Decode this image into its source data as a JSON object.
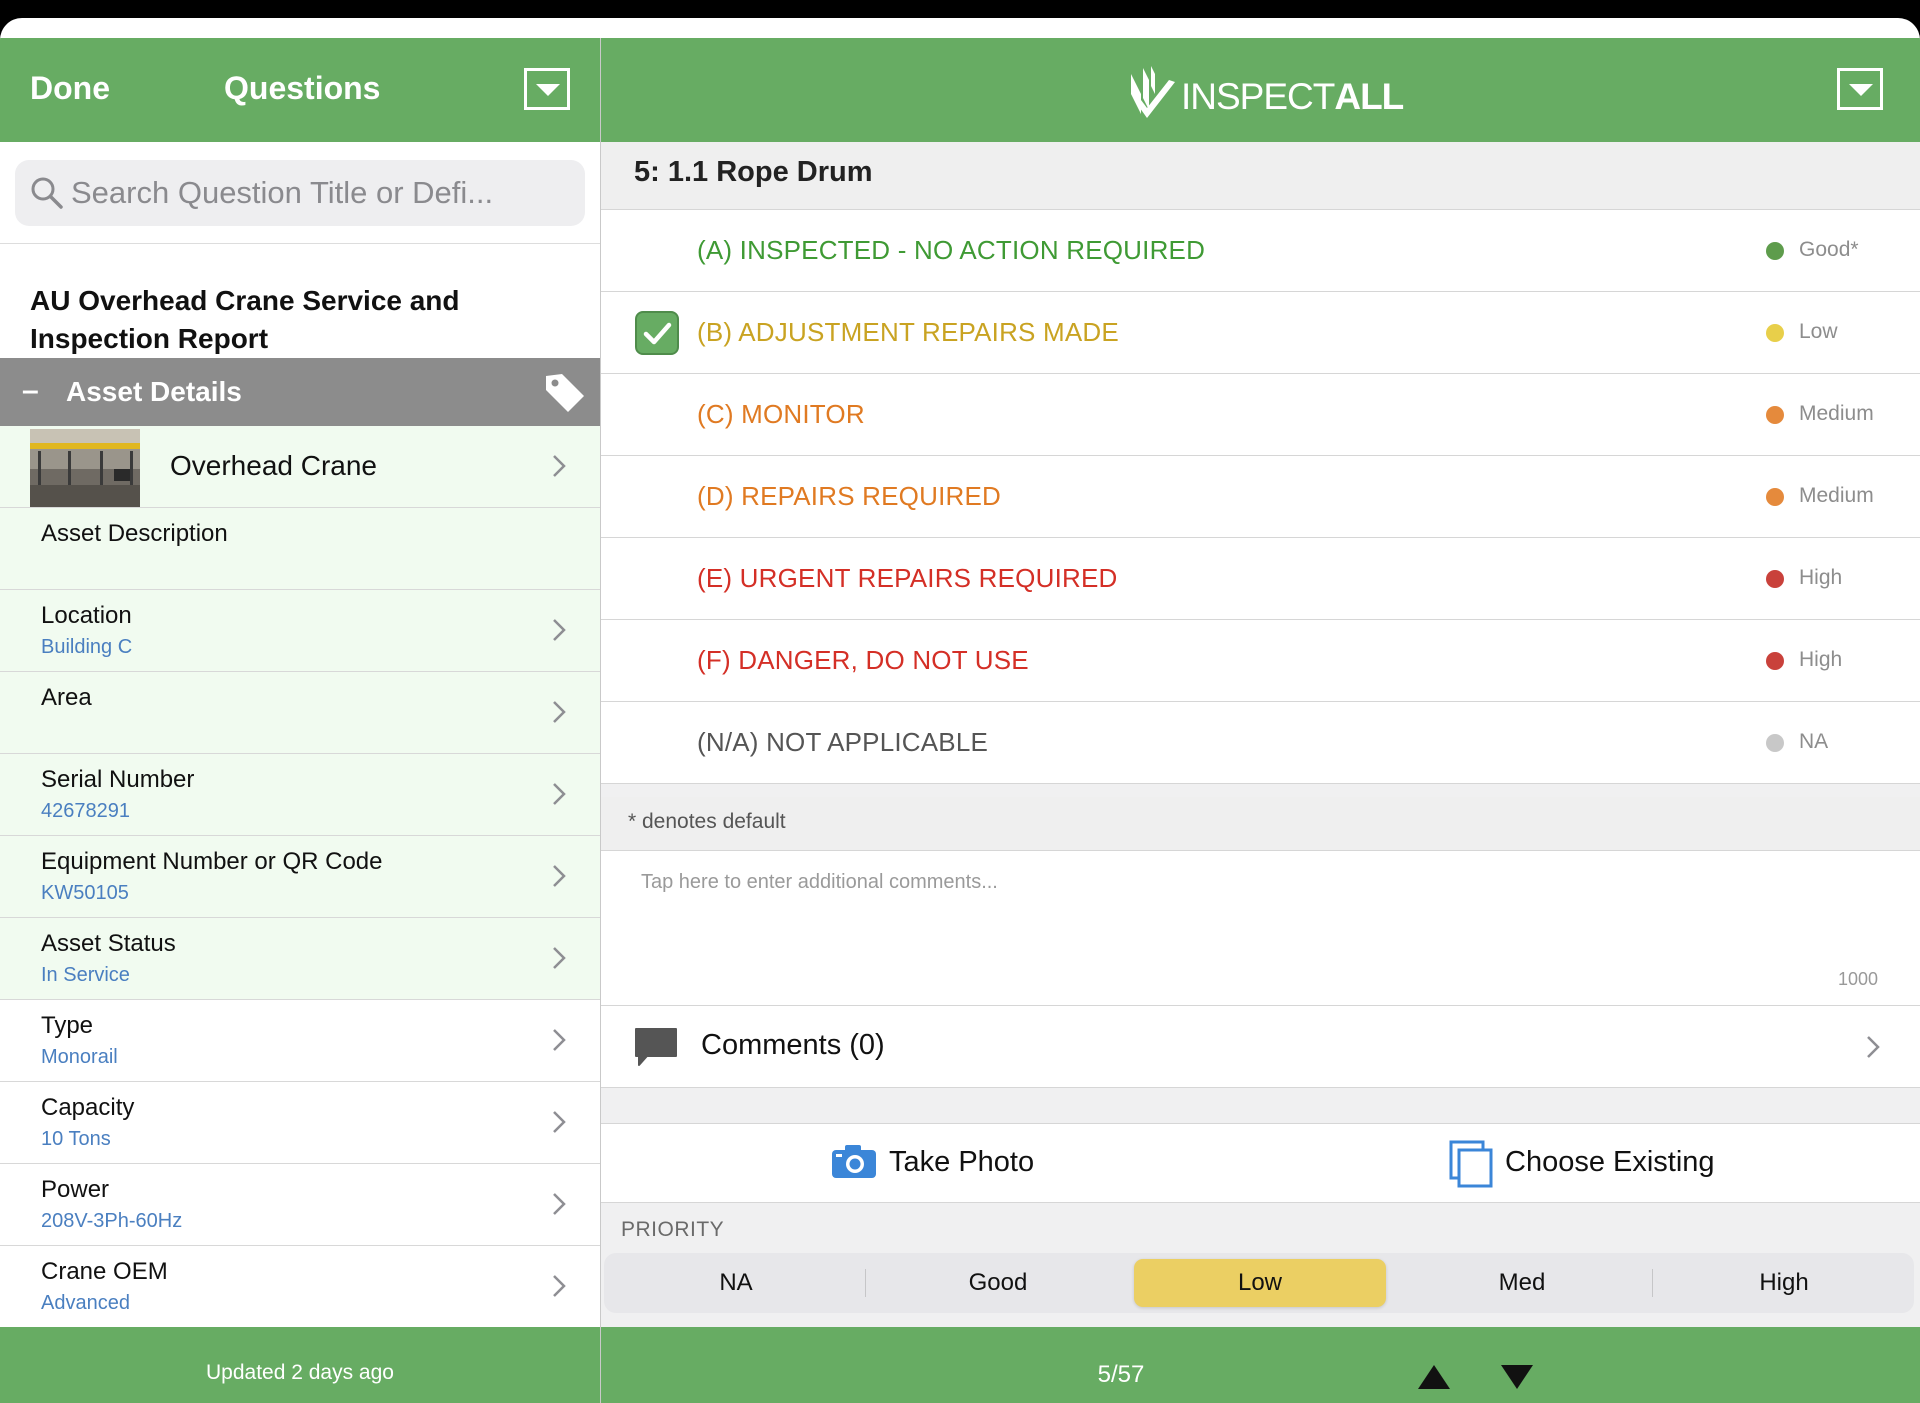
{
  "left": {
    "done_label": "Done",
    "title": "Questions",
    "search_placeholder": "Search Question Title or Defi...",
    "report_title": "AU Overhead Crane Service and Inspection Report",
    "section": {
      "toggle": "–",
      "title": "Asset Details"
    },
    "asset_name": "Overhead Crane",
    "fields": [
      {
        "label": "Asset Description",
        "value": ""
      },
      {
        "label": "Location",
        "value": "Building C"
      },
      {
        "label": "Area",
        "value": ""
      },
      {
        "label": "Serial Number",
        "value": "42678291"
      },
      {
        "label": "Equipment Number or QR Code",
        "value": "KW50105"
      },
      {
        "label": "Asset Status",
        "value": "In Service"
      },
      {
        "label": "Type",
        "value": "Monorail"
      },
      {
        "label": "Capacity",
        "value": "10 Tons"
      },
      {
        "label": "Power",
        "value": "208V-3Ph-60Hz"
      },
      {
        "label": "Crane OEM",
        "value": "Advanced"
      }
    ],
    "footer": "Updated 2 days ago"
  },
  "right": {
    "logo_text_light": "INSPECT",
    "logo_text_bold": "ALL",
    "question_title": "5: 1.1 Rope Drum",
    "options": [
      {
        "text": "(A) INSPECTED - NO ACTION REQUIRED",
        "priority": "Good*",
        "text_color": "#3f9a34",
        "dot_color": "#5e9c4c",
        "selected": false
      },
      {
        "text": "(B) ADJUSTMENT REPAIRS MADE",
        "priority": "Low",
        "text_color": "#c9a322",
        "dot_color": "#e8cf4a",
        "selected": true
      },
      {
        "text": "(C) MONITOR",
        "priority": "Medium",
        "text_color": "#e07a22",
        "dot_color": "#e58a3c",
        "selected": false
      },
      {
        "text": "(D) REPAIRS REQUIRED",
        "priority": "Medium",
        "text_color": "#e07a22",
        "dot_color": "#e58a3c",
        "selected": false
      },
      {
        "text": "(E) URGENT REPAIRS REQUIRED",
        "priority": "High",
        "text_color": "#d42f26",
        "dot_color": "#c9413b",
        "selected": false
      },
      {
        "text": "(F) DANGER, DO NOT USE",
        "priority": "High",
        "text_color": "#d42f26",
        "dot_color": "#c9413b",
        "selected": false
      },
      {
        "text": "(N/A) NOT APPLICABLE",
        "priority": "NA",
        "text_color": "#555555",
        "dot_color": "#c8c8c8",
        "selected": false
      }
    ],
    "default_note": "* denotes default",
    "comment_placeholder": "Tap here to enter additional comments...",
    "comment_limit": "1000",
    "comments_label": "Comments (0)",
    "take_photo": "Take Photo",
    "choose_existing": "Choose Existing",
    "priority_label": "PRIORITY",
    "priority_segments": [
      "NA",
      "Good",
      "Low",
      "Med",
      "High"
    ],
    "priority_selected": "Low",
    "page_indicator": "5/57"
  },
  "colors": {
    "brand_green": "#67ac63",
    "link_blue": "#4a7fc0",
    "low_yellow": "#ebcf63"
  },
  "icons": [
    "dropdown-icon",
    "search-icon",
    "tag-icon",
    "chevron-right-icon",
    "checkmark-icon",
    "comment-bubble-icon",
    "camera-icon",
    "photo-library-icon",
    "arrow-up-icon",
    "arrow-down-icon"
  ]
}
